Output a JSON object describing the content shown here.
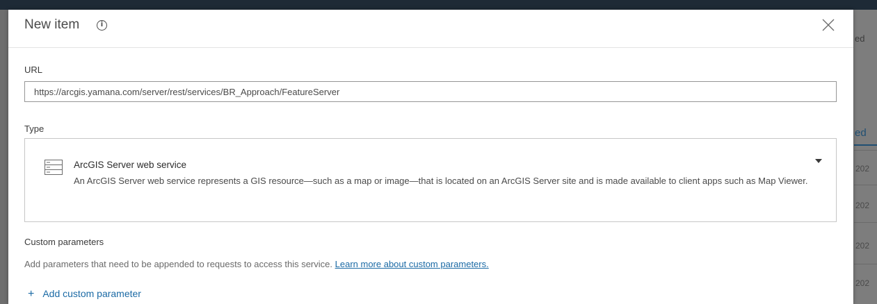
{
  "background": {
    "visible_text_1": "ed",
    "visible_text_2": "ed",
    "years": [
      "202",
      "202",
      "202",
      "202"
    ]
  },
  "dialog": {
    "title": "New item",
    "info_icon_glyph": "i",
    "close_icon": "close-icon"
  },
  "url_field": {
    "label": "URL",
    "value": "https://arcgis.yamana.com/server/rest/services/BR_Approach/FeatureServer"
  },
  "type_field": {
    "label": "Type",
    "selected": {
      "icon": "server-icon",
      "title": "ArcGIS Server web service",
      "description": "An ArcGIS Server web service represents a GIS resource—such as a map or image—that is located on an ArcGIS Server site and is made available to client apps such as Map Viewer."
    }
  },
  "custom_parameters": {
    "label": "Custom parameters",
    "description": "Add parameters that need to be appended to requests to access this service.",
    "link_text": "Learn more about custom parameters.",
    "add_button_icon": "+",
    "add_button_label": "Add custom parameter"
  },
  "colors": {
    "accent": "#1b6aa5",
    "text": "#4a4a4a",
    "overlay": "#727272"
  }
}
